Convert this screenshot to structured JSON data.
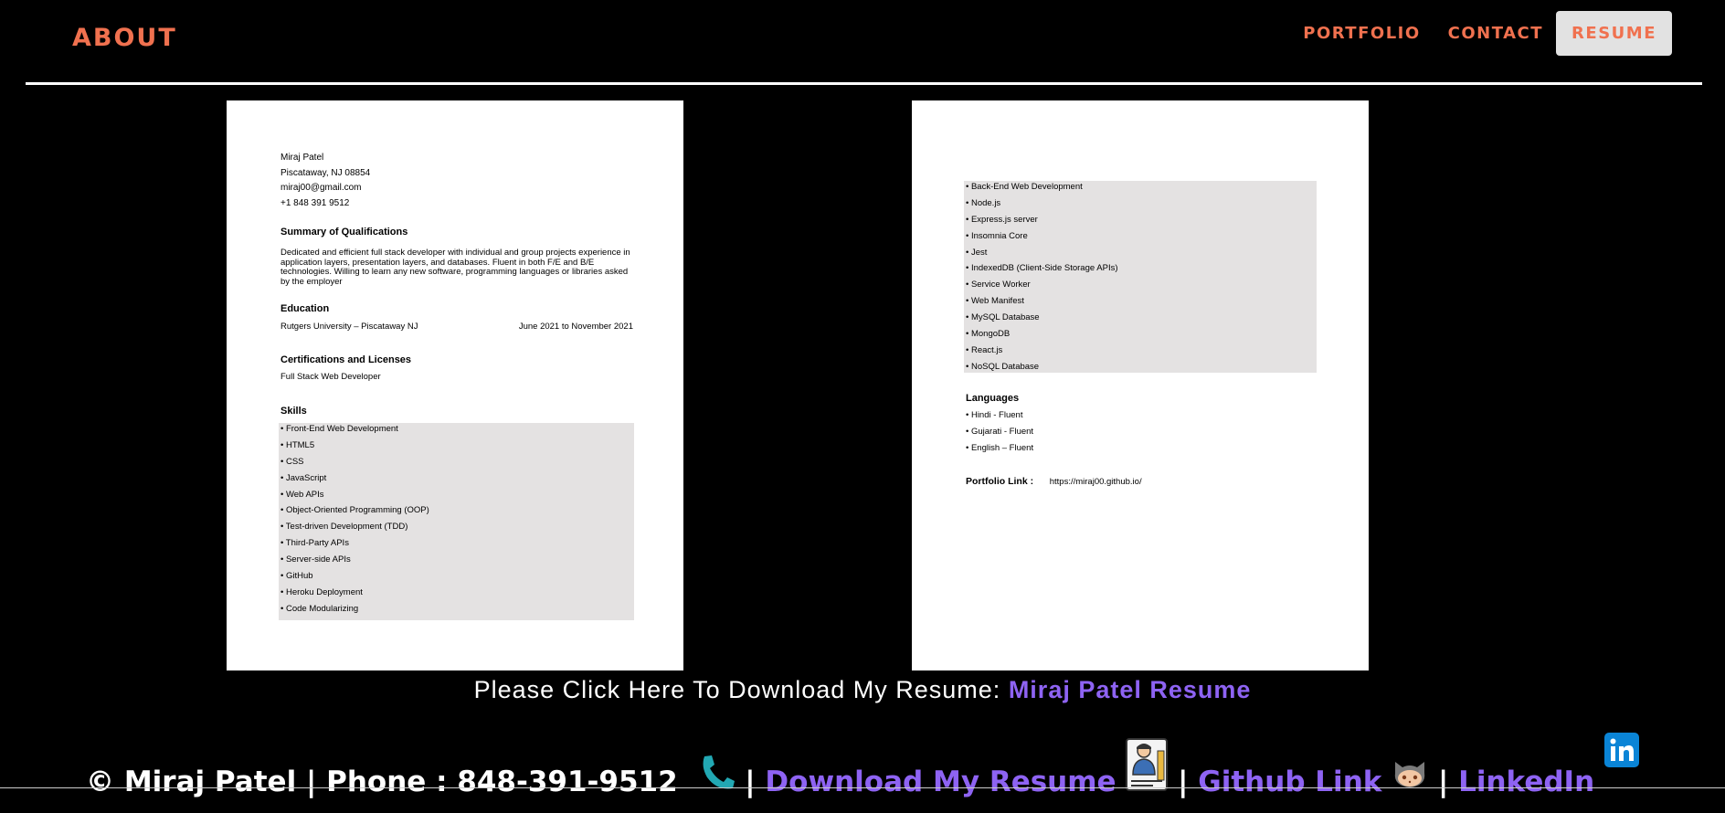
{
  "nav": {
    "about": "ABOUT",
    "portfolio": "PORTFOLIO",
    "contact": "CONTACT",
    "resume": "RESUME"
  },
  "resume_page1": {
    "name": "Miraj Patel",
    "location": "Piscataway, NJ 08854",
    "email": "miraj00@gmail.com",
    "phone": "+1 848 391 9512",
    "summary_heading": "Summary of Qualifications",
    "summary_text": "Dedicated and efficient full stack developer with individual and group projects experience in application layers, presentation layers, and databases. Fluent in both F/E and B/E technologies. Willing to learn any new software, programming languages or libraries asked by the employer",
    "education_heading": "Education",
    "education_school": "Rutgers University – Piscataway NJ",
    "education_dates": "June 2021 to November 2021",
    "cert_heading": "Certifications and Licenses",
    "cert_item": "Full Stack Web Developer",
    "skills_heading": "Skills",
    "skills": [
      "• Front-End Web Development",
      "• HTML5",
      "• CSS",
      "• JavaScript",
      "• Web APIs",
      "• Object-Oriented Programming (OOP)",
      "• Test-driven Development (TDD)",
      "• Third-Party APIs",
      "• Server-side APIs",
      "• GitHub",
      " • Heroku Deployment",
      "• Code Modularizing"
    ]
  },
  "resume_page2": {
    "skills": [
      "• Back-End Web Development",
      "• Node.js",
      "• Express.js server",
      "• Insomnia Core",
      "• Jest",
      "• IndexedDB (Client-Side Storage APIs)",
      "• Service Worker",
      "• Web Manifest",
      "• MySQL Database",
      "• MongoDB",
      "• React.js",
      "• NoSQL Database"
    ],
    "languages_heading": "Languages",
    "languages": [
      "• Hindi - Fluent",
      "• Gujarati - Fluent",
      "• English – Fluent"
    ],
    "portfolio_label": "Portfolio Link :",
    "portfolio_url": "https://miraj00.github.io/"
  },
  "download": {
    "prompt": "Please Click Here To Download My Resume:",
    "link": "Miraj Patel Resume"
  },
  "footer": {
    "copyright": "© Miraj Patel | Phone : 848-391-9512",
    "sep": "|",
    "download_link": "Download My Resume",
    "github_link": "Github Link",
    "linkedin_link": "LinkedIn"
  },
  "icons": {
    "phone": "phone-icon",
    "resume": "resume-person-icon",
    "github": "github-octocat-icon",
    "linkedin": "linkedin-icon"
  },
  "colors": {
    "nav_accent": "#f0714f",
    "link_purple": "#8e63f3",
    "skill_bg": "#e4e2e2",
    "linkedin_blue": "#0a84d6",
    "phone_teal": "#22a8b3"
  }
}
